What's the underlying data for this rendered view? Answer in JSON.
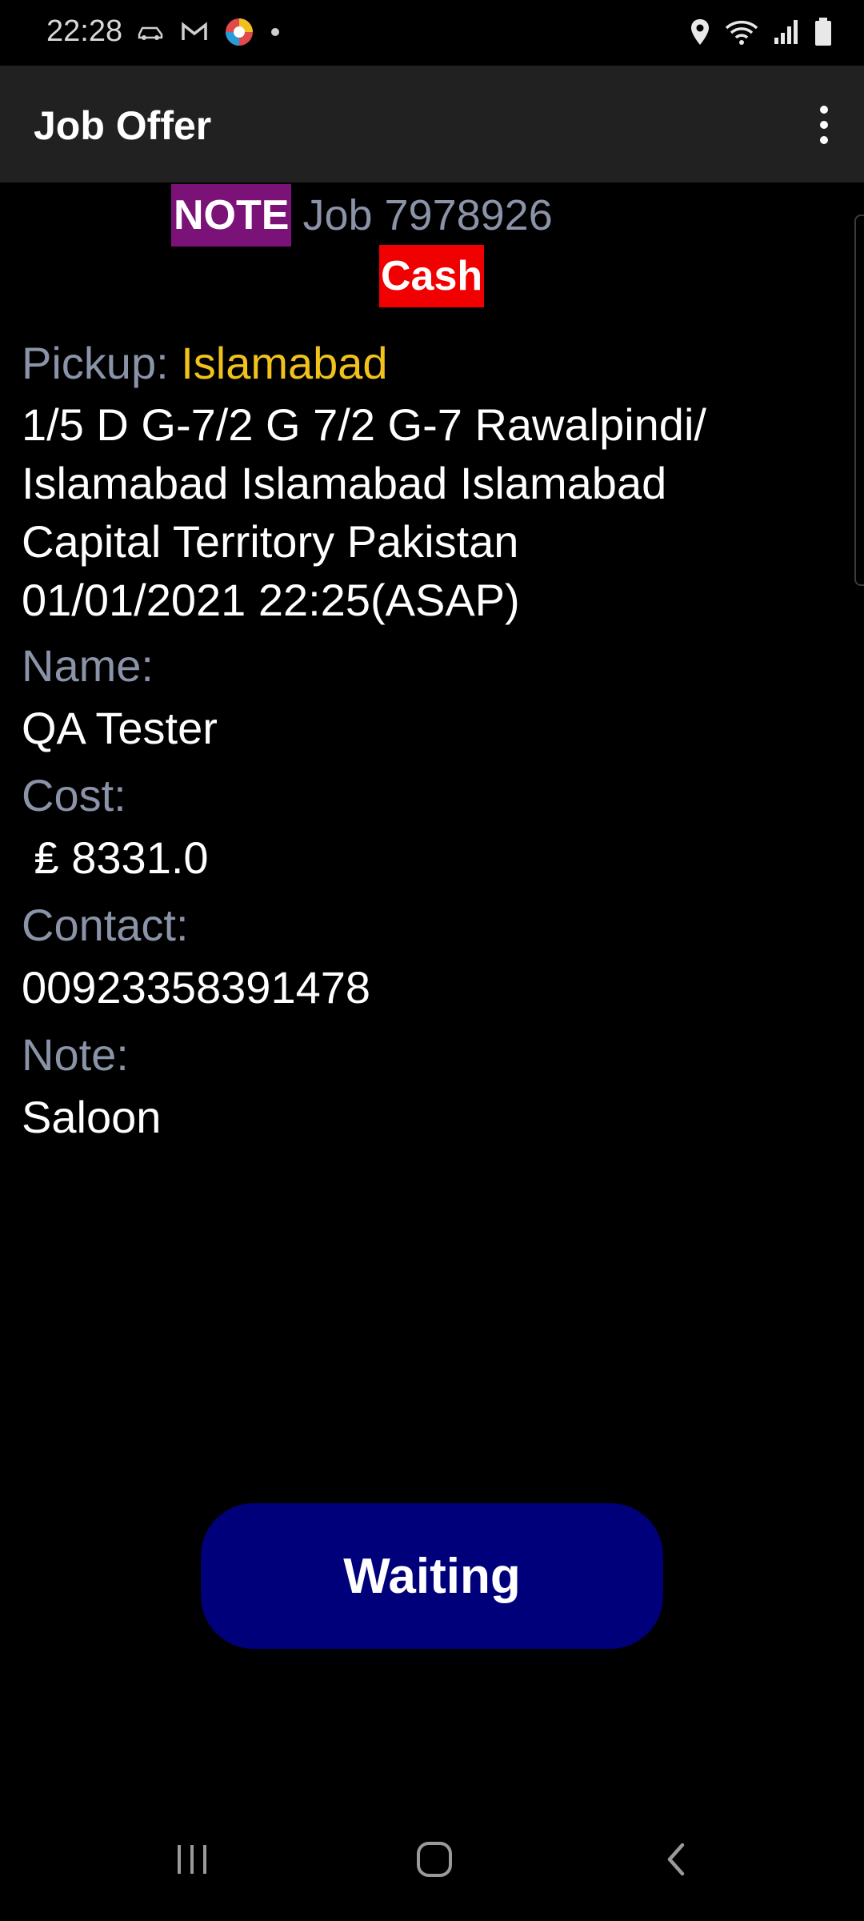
{
  "status_bar": {
    "time": "22:28",
    "left_icons": [
      "car-icon",
      "gmail-icon",
      "app-icon",
      "dot-icon"
    ],
    "right_icons": [
      "location-icon",
      "wifi-icon",
      "signal-icon",
      "battery-icon"
    ]
  },
  "app_bar": {
    "title": "Job Offer",
    "menu_icon": "more-vert-icon"
  },
  "job": {
    "note_badge": "NOTE",
    "job_label": "Job 7978926",
    "payment_badge": "Cash"
  },
  "details": {
    "pickup_label": "Pickup:",
    "pickup_city": "Islamabad",
    "address_line1": "1/5 D G-7/2 G 7/2 G-7 Rawalpindi/",
    "address_line2": "Islamabad Islamabad Islamabad",
    "address_line3": "Capital Territory Pakistan",
    "address_line4": "01/01/2021 22:25(ASAP)",
    "name_label": "Name:",
    "name_value": "QA Tester",
    "cost_label": "Cost:",
    "cost_value": " ₤ 8331.0",
    "contact_label": "Contact:",
    "contact_value": "00923358391478",
    "note_label": "Note:",
    "note_value": "Saloon"
  },
  "actions": {
    "waiting_label": "Waiting"
  },
  "navigation": {
    "recents_icon": "recents-icon",
    "home_icon": "home-icon",
    "back_icon": "back-icon"
  },
  "colors": {
    "note_badge_bg": "#7b1277",
    "cash_badge_bg": "#f00000",
    "pickup_city": "#f1c21b",
    "label_gray": "#8a93a8",
    "waiting_button_bg": "#00007a",
    "app_bar_bg": "#212121"
  }
}
